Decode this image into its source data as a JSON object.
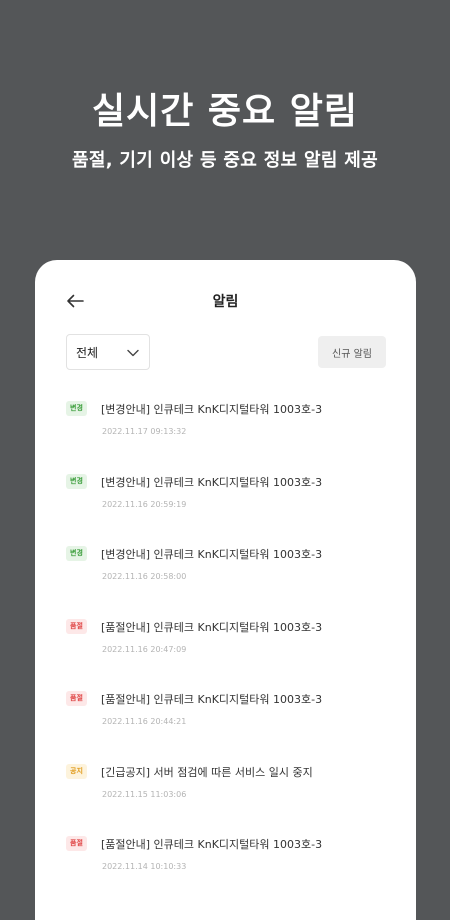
{
  "promo": {
    "title": "실시간 중요 알림",
    "subtitle": "품절, 기기 이상 등 중요 정보 알림 제공"
  },
  "header": {
    "back_icon": "arrow-left-icon",
    "title": "알림"
  },
  "filter": {
    "selected": "전체",
    "icon": "chevron-down-icon"
  },
  "new_button_label": "신규 알림",
  "colors": {
    "background": "#545658",
    "change_badge": "#3b9d3b",
    "soldout_badge": "#e04848",
    "notice_badge": "#e09a1a"
  },
  "notifications": [
    {
      "badge": "변경",
      "type": "change",
      "title": "[변경안내] 인큐테크 KnK디지털타워 1003호-3",
      "time": "2022.11.17 09:13:32"
    },
    {
      "badge": "변경",
      "type": "change",
      "title": "[변경안내] 인큐테크 KnK디지털타워 1003호-3",
      "time": "2022.11.16 20:59:19"
    },
    {
      "badge": "변경",
      "type": "change",
      "title": "[변경안내] 인큐테크 KnK디지털타워 1003호-3",
      "time": "2022.11.16 20:58:00"
    },
    {
      "badge": "품절",
      "type": "soldout",
      "title": "[품절안내] 인큐테크 KnK디지털타워 1003호-3",
      "time": "2022.11.16 20:47:09"
    },
    {
      "badge": "품절",
      "type": "soldout",
      "title": "[품절안내] 인큐테크 KnK디지털타워 1003호-3",
      "time": "2022.11.16 20:44:21"
    },
    {
      "badge": "공지",
      "type": "notice",
      "title": "[긴급공지] 서버 점검에 따른 서비스 일시 중지",
      "time": "2022.11.15 11:03:06"
    },
    {
      "badge": "품절",
      "type": "soldout",
      "title": "[품절안내] 인큐테크 KnK디지털타워 1003호-3",
      "time": "2022.11.14 10:10:33"
    }
  ]
}
